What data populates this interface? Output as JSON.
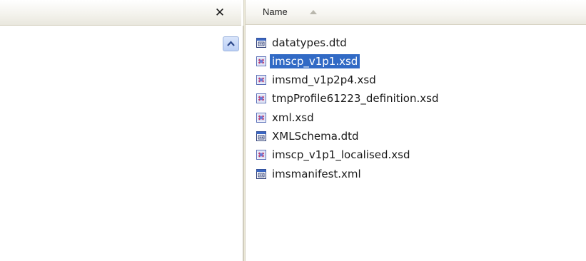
{
  "left_pane": {
    "close_icon": "close-icon",
    "close_glyph": "✕",
    "scroll_up_icon": "chevron-up-icon"
  },
  "column_header": {
    "name_label": "Name",
    "sort_icon": "sort-ascending-icon"
  },
  "files": [
    {
      "name": "datatypes.dtd",
      "type": "dtd",
      "selected": false
    },
    {
      "name": "imscp_v1p1.xsd",
      "type": "xsd",
      "selected": true
    },
    {
      "name": "imsmd_v1p2p4.xsd",
      "type": "xsd",
      "selected": false
    },
    {
      "name": "tmpProfile61223_definition.xsd",
      "type": "xsd",
      "selected": false
    },
    {
      "name": "xml.xsd",
      "type": "xsd",
      "selected": false
    },
    {
      "name": "XMLSchema.dtd",
      "type": "dtd",
      "selected": false
    },
    {
      "name": "imscp_v1p1_localised.xsd",
      "type": "xsd",
      "selected": false
    },
    {
      "name": "imsmanifest.xml",
      "type": "dtd",
      "selected": false
    }
  ],
  "colors": {
    "selection": "#316ac5",
    "xsd_icon": "#6a7dd8",
    "dtd_icon": "#3a66c2"
  }
}
